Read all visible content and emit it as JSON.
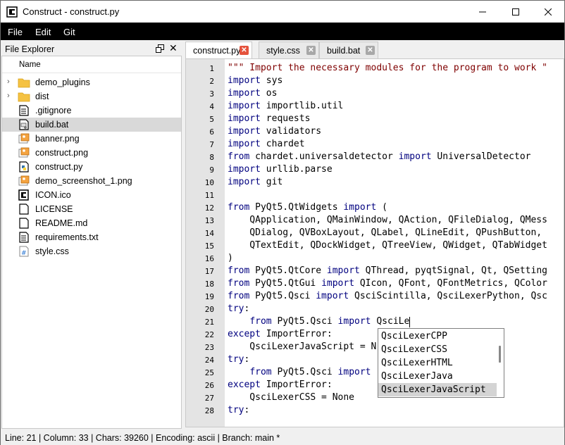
{
  "window": {
    "title": "Construct - construct.py",
    "minimize_glyph": "—",
    "maximize_glyph": "☐",
    "close_glyph": "✕"
  },
  "menu": {
    "items": [
      "File",
      "Edit",
      "Git"
    ]
  },
  "file_explorer": {
    "title": "File Explorer",
    "column_header": "Name",
    "selected_index": 3,
    "items": [
      {
        "name": "demo_plugins",
        "type": "folder",
        "icon": "folder-icon"
      },
      {
        "name": "dist",
        "type": "folder",
        "icon": "folder-icon"
      },
      {
        "name": ".gitignore",
        "type": "file",
        "icon": "text-file-icon"
      },
      {
        "name": "build.bat",
        "type": "file",
        "icon": "batch-file-icon"
      },
      {
        "name": "banner.png",
        "type": "file",
        "icon": "image-file-icon"
      },
      {
        "name": "construct.png",
        "type": "file",
        "icon": "image-file-icon"
      },
      {
        "name": "construct.py",
        "type": "file",
        "icon": "python-file-icon"
      },
      {
        "name": "demo_screenshot_1.png",
        "type": "file",
        "icon": "image-file-icon"
      },
      {
        "name": "ICON.ico",
        "type": "file",
        "icon": "ico-file-icon"
      },
      {
        "name": "LICENSE",
        "type": "file",
        "icon": "blank-file-icon"
      },
      {
        "name": "README.md",
        "type": "file",
        "icon": "blank-file-icon"
      },
      {
        "name": "requirements.txt",
        "type": "file",
        "icon": "text-file-icon"
      },
      {
        "name": "style.css",
        "type": "file",
        "icon": "css-file-icon"
      }
    ]
  },
  "tabs": [
    {
      "label": "construct.py",
      "active": true,
      "close_color": "#e5533d"
    },
    {
      "label": "style.css",
      "active": false,
      "close_color": "#a8a8a8"
    },
    {
      "label": "build.bat",
      "active": false,
      "close_color": "#a8a8a8"
    }
  ],
  "editor": {
    "cursor_line": 21,
    "lines": [
      {
        "n": "1",
        "text": "\"\"\" Import the necessary modules for the program to work \""
      },
      {
        "n": "2",
        "text": "import sys"
      },
      {
        "n": "3",
        "text": "import os"
      },
      {
        "n": "4",
        "text": "import importlib.util"
      },
      {
        "n": "5",
        "text": "import requests"
      },
      {
        "n": "6",
        "text": "import validators"
      },
      {
        "n": "7",
        "text": "import chardet"
      },
      {
        "n": "8",
        "text": "from chardet.universaldetector import UniversalDetector"
      },
      {
        "n": "9",
        "text": "import urllib.parse"
      },
      {
        "n": "10",
        "text": "import git"
      },
      {
        "n": "11",
        "text": ""
      },
      {
        "n": "12",
        "text": "from PyQt5.QtWidgets import ("
      },
      {
        "n": "13",
        "text": "    QApplication, QMainWindow, QAction, QFileDialog, QMess"
      },
      {
        "n": "14",
        "text": "    QDialog, QVBoxLayout, QLabel, QLineEdit, QPushButton,"
      },
      {
        "n": "15",
        "text": "    QTextEdit, QDockWidget, QTreeView, QWidget, QTabWidget"
      },
      {
        "n": "16",
        "text": ")"
      },
      {
        "n": "17",
        "text": "from PyQt5.QtCore import QThread, pyqtSignal, Qt, QSetting"
      },
      {
        "n": "18",
        "text": "from PyQt5.QtGui import QIcon, QFont, QFontMetrics, QColor"
      },
      {
        "n": "19",
        "text": "from PyQt5.Qsci import QsciScintilla, QsciLexerPython, Qsc"
      },
      {
        "n": "20",
        "text": "try:"
      },
      {
        "n": "21",
        "text": "    from PyQt5.Qsci import QsciLe"
      },
      {
        "n": "22",
        "text": "except ImportError:"
      },
      {
        "n": "23",
        "text": "    QsciLexerJavaScript = N"
      },
      {
        "n": "24",
        "text": "try:"
      },
      {
        "n": "25",
        "text": "    from PyQt5.Qsci import"
      },
      {
        "n": "26",
        "text": "except ImportError:"
      },
      {
        "n": "27",
        "text": "    QsciLexerCSS = None"
      },
      {
        "n": "28",
        "text": "try:"
      }
    ]
  },
  "autocomplete": {
    "selected_index": 4,
    "items": [
      "QsciLexerCPP",
      "QsciLexerCSS",
      "QsciLexerHTML",
      "QsciLexerJava",
      "QsciLexerJavaScript"
    ]
  },
  "status": {
    "text": "Line: 21 | Column: 33 | Chars: 39260 | Encoding: ascii | Branch: main *"
  },
  "colors": {
    "keyword": "#00007f",
    "string": "#7f0000",
    "menubar": "#000000",
    "selection": "#d9d9d9"
  }
}
